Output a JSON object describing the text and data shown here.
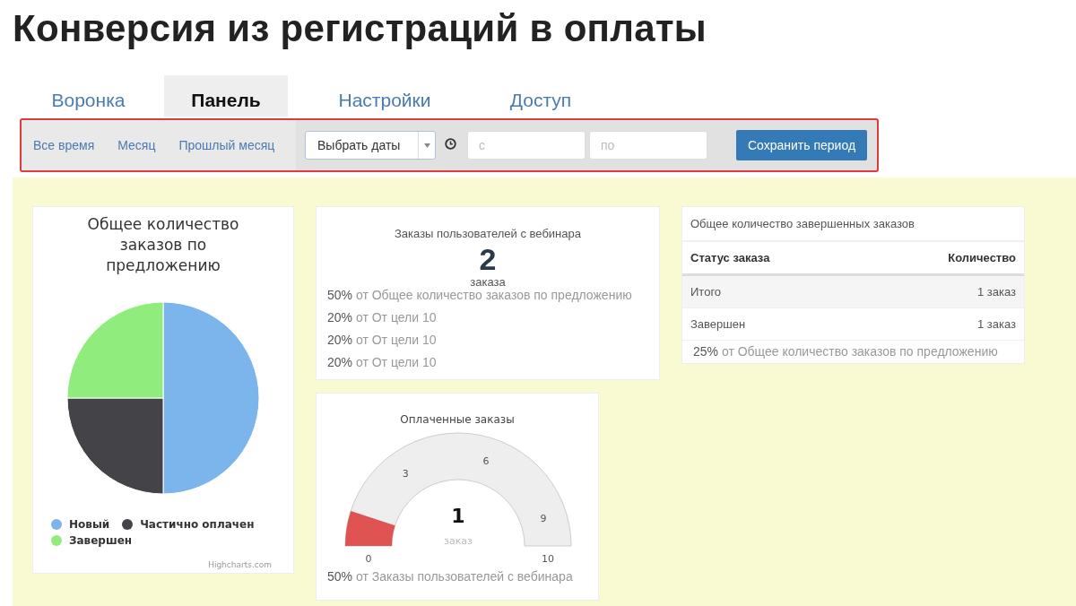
{
  "page_title": "Конверсия из регистраций в оплаты",
  "tabs": [
    {
      "label": "Воронка",
      "selected": false
    },
    {
      "label": "Панель",
      "selected": true
    },
    {
      "label": "Настройки",
      "selected": false
    },
    {
      "label": "Доступ",
      "selected": false
    }
  ],
  "filter": {
    "quick_ranges": [
      "Все время",
      "Месяц",
      "Прошлый месяц"
    ],
    "date_mode": "Выбрать даты",
    "from": {
      "placeholder": "с"
    },
    "to": {
      "placeholder": "по"
    },
    "save_button": "Сохранить период"
  },
  "pie_card": {
    "chart_data": {
      "type": "pie",
      "title": "Общее количество заказов по предложению",
      "categories": [
        "Новый",
        "Частично оплачен",
        "Завершен"
      ],
      "values": [
        50,
        25,
        25
      ],
      "colors": [
        "#7cb5ec",
        "#434348",
        "#90ed7d"
      ]
    },
    "credit": "Highcharts.com"
  },
  "stat_card": {
    "title": "Заказы пользователей с вебинара",
    "value": "2",
    "unit": "заказа",
    "shares": [
      {
        "percent": "50%",
        "text": "от Общее количество заказов по предложению"
      },
      {
        "percent": "20%",
        "text": "от От цели 10"
      },
      {
        "percent": "20%",
        "text": "от От цели 10"
      },
      {
        "percent": "20%",
        "text": "от От цели 10"
      }
    ]
  },
  "gauge_card": {
    "title": "Оплаченные заказы",
    "level": 0.1,
    "value": "1",
    "unit": "заказ",
    "tick_labels": [
      "0",
      "3",
      "6",
      "9",
      "10"
    ],
    "share": {
      "percent": "50%",
      "text": "от Заказы пользователей с вебинара"
    }
  },
  "table_card": {
    "title": "Общее количество завершенных заказов",
    "columns": [
      "Статус заказа",
      "Количество"
    ],
    "rows": [
      {
        "cells": [
          "Итого",
          "1 заказ"
        ]
      },
      {
        "cells": [
          "Завершен",
          "1 заказ"
        ]
      }
    ],
    "share": {
      "percent": "25%",
      "text": "от Общее количество заказов по предложению"
    }
  }
}
